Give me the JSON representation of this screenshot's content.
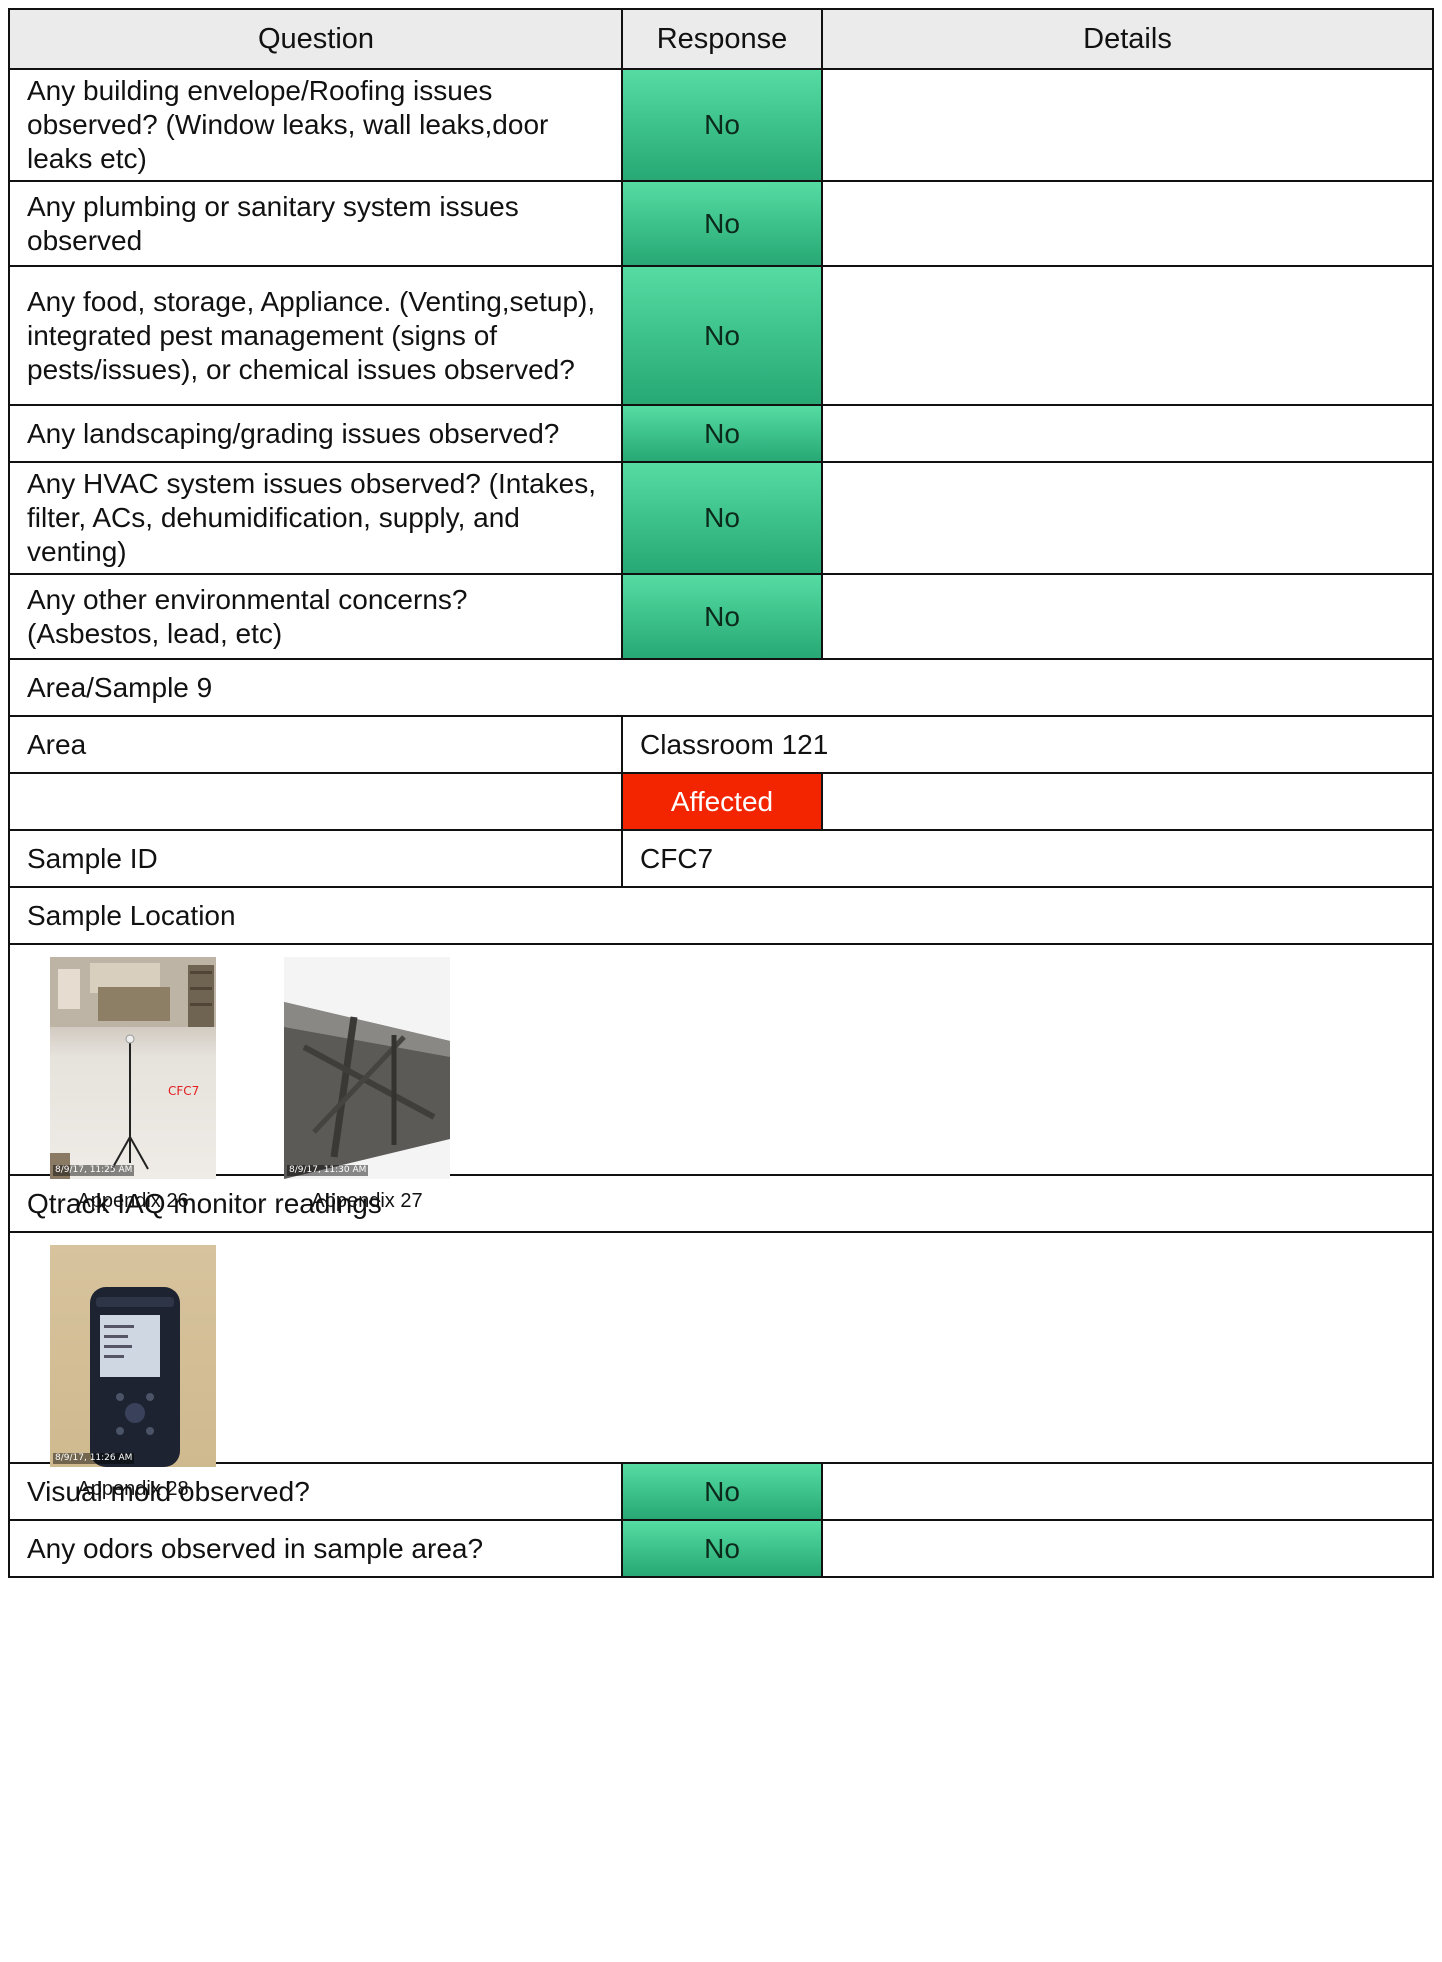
{
  "table": {
    "headers": {
      "question": "Question",
      "response": "Response",
      "details": "Details"
    },
    "questions": [
      {
        "question": "Any building envelope/Roofing issues observed? (Window leaks, wall leaks,door leaks etc)",
        "response": "No",
        "details": ""
      },
      {
        "question": "Any plumbing or sanitary system issues observed",
        "response": "No",
        "details": ""
      },
      {
        "question": "Any food, storage, Appliance. (Venting,setup), integrated pest management (signs of pests/issues), or chemical issues observed?",
        "response": "No",
        "details": ""
      },
      {
        "question": "Any landscaping/grading issues observed?",
        "response": "No",
        "details": ""
      },
      {
        "question": "Any HVAC system issues observed? (Intakes, filter, ACs, dehumidification, supply, and venting)",
        "response": "No",
        "details": ""
      },
      {
        "question": "Any other environmental concerns? (Asbestos, lead, etc)",
        "response": "No",
        "details": ""
      }
    ],
    "section_title": "Area/Sample 9",
    "area_label": "Area",
    "area_value": "Classroom 121",
    "status": "Affected",
    "sample_id_label": "Sample ID",
    "sample_id_value": "CFC7",
    "sample_location_label": "Sample Location",
    "sample_photos": [
      {
        "caption": "Appendix 26",
        "stamp": "8/9/17, 11:25 AM",
        "overlay": "CFC7"
      },
      {
        "caption": "Appendix 27",
        "stamp": "8/9/17, 11:30 AM"
      }
    ],
    "monitor_label": "Qtrack IAQ monitor readings",
    "monitor_photos": [
      {
        "caption": "Appendix 28",
        "stamp": "8/9/17, 11:26 AM"
      }
    ],
    "bottom_questions": [
      {
        "question": "Visual mold observed?",
        "response": "No"
      },
      {
        "question": "Any odors observed in sample area?",
        "response": "No"
      }
    ]
  },
  "colors": {
    "no_green_top": "#55dca3",
    "no_green_bottom": "#27a874",
    "affected_red": "#f32400",
    "header_gray": "#ebebeb"
  }
}
